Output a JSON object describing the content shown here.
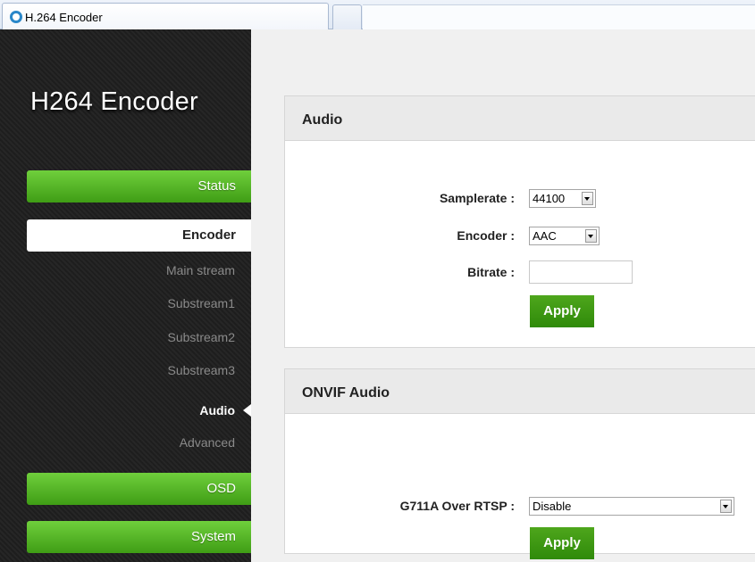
{
  "browser": {
    "tab_title": "H.264 Encoder"
  },
  "sidebar": {
    "brand": "H264 Encoder",
    "status_label": "Status",
    "encoder_label": "Encoder",
    "sub_items": [
      "Main stream",
      "Substream1",
      "Substream2",
      "Substream3",
      "Audio",
      "Advanced"
    ],
    "osd_label": "OSD",
    "system_label": "System"
  },
  "audio_panel": {
    "title": "Audio",
    "samplerate_label": "Samplerate :",
    "samplerate_value": "44100",
    "encoder_label": "Encoder :",
    "encoder_value": "AAC",
    "bitrate_label": "Bitrate :",
    "bitrate_value": "",
    "apply_label": "Apply"
  },
  "onvif_panel": {
    "title": "ONVIF Audio",
    "g711a_label": "G711A Over RTSP :",
    "g711a_value": "Disable",
    "apply_label": "Apply"
  }
}
